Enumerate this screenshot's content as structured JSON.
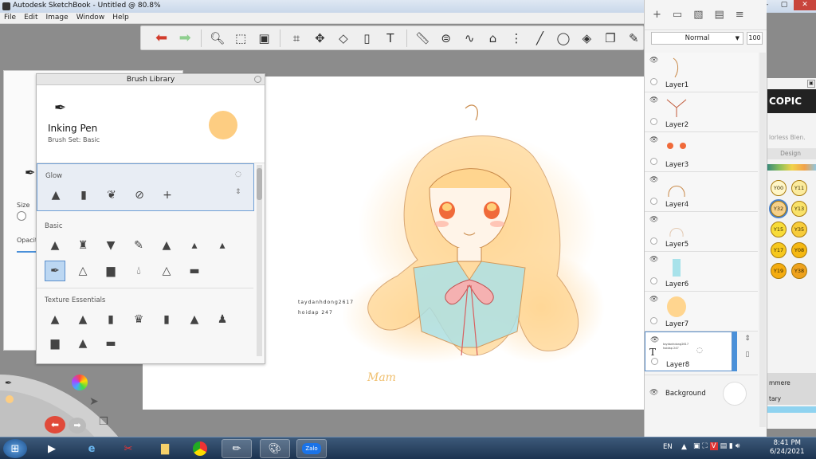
{
  "window": {
    "title": "Autodesk SketchBook - Untitled @ 80.8%"
  },
  "menu": [
    "File",
    "Edit",
    "Image",
    "Window",
    "Help"
  ],
  "brush_library": {
    "title": "Brush Library",
    "current_brush": "Inking Pen",
    "brush_set": "Brush Set: Basic",
    "current_color": "#fdcd82",
    "sections": [
      "Glow",
      "Basic",
      "Texture Essentials"
    ]
  },
  "side_panel": {
    "size_label": "Size",
    "opacity_label": "Opacit"
  },
  "layers": {
    "blend_mode": "Normal",
    "opacity": "100",
    "items": [
      "Layer1",
      "Layer2",
      "Layer3",
      "Layer4",
      "Layer5",
      "Layer6",
      "Layer7",
      "Layer8"
    ],
    "selected": "Layer8",
    "background_label": "Background",
    "layer8_text": [
      "taydanhdong2617",
      "hoidap 247"
    ]
  },
  "canvas": {
    "text_lines": [
      "taydanhdong2617",
      "hoidap 247"
    ],
    "signature": "Mam"
  },
  "copic": {
    "logo": "COPIC",
    "label_colorless": "lorless Blen.",
    "tab_design": "Design",
    "swatches": [
      "Y00",
      "Y11",
      "Y32",
      "Y13",
      "Y15",
      "Y35",
      "Y17",
      "Y08",
      "Y19",
      "Y38"
    ],
    "selected_swatch": "Y32",
    "bottom_labels": [
      "mmere",
      "tary"
    ]
  },
  "taskbar": {
    "apps": [
      "start",
      "media",
      "ie",
      "snip",
      "folder",
      "chrome",
      "sketchbook",
      "paint",
      "zalo"
    ],
    "zalo_label": "Zalo",
    "lang": "EN",
    "time": "8:41 PM",
    "date": "6/24/2021"
  }
}
